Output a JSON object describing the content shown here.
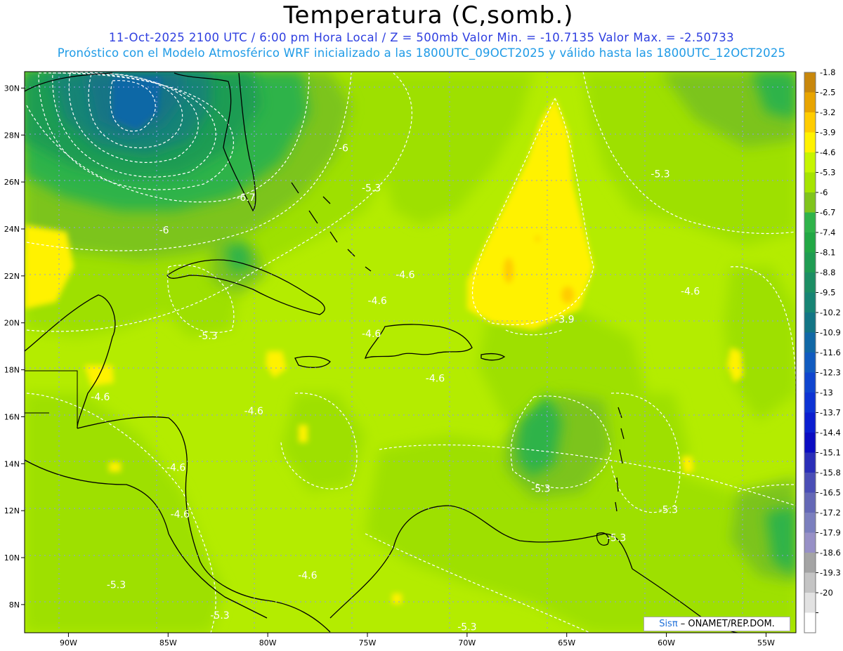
{
  "header": {
    "title": "Temperatura (C,somb.)",
    "subtitle_line1": "11-Oct-2025  2100 UTC / 6:00 pm Hora Local / Z = 500mb  Valor Min. = -10.7135  Valor Max. = -2.50733",
    "subtitle_line2": "Pronóstico con el Modelo Atmosférico WRF inicializado a las 1800UTC_09OCT2025 y válido hasta las  1800UTC_12OCT2025"
  },
  "map": {
    "projection": "lat-lon",
    "lon_range": [
      -92.2,
      -53.5
    ],
    "lat_range": [
      6.8,
      30.7
    ],
    "lon_ticks": [
      {
        "value": -90,
        "label": "90W"
      },
      {
        "value": -85,
        "label": "85W"
      },
      {
        "value": -80,
        "label": "80W"
      },
      {
        "value": -75,
        "label": "75W"
      },
      {
        "value": -70,
        "label": "70W"
      },
      {
        "value": -65,
        "label": "65W"
      },
      {
        "value": -60,
        "label": "60W"
      },
      {
        "value": -55,
        "label": "55W"
      }
    ],
    "lat_ticks": [
      {
        "value": 30,
        "label": "30N"
      },
      {
        "value": 28,
        "label": "28N"
      },
      {
        "value": 26,
        "label": "26N"
      },
      {
        "value": 24,
        "label": "24N"
      },
      {
        "value": 22,
        "label": "22N"
      },
      {
        "value": 20,
        "label": "20N"
      },
      {
        "value": 18,
        "label": "18N"
      },
      {
        "value": 16,
        "label": "16N"
      },
      {
        "value": 14,
        "label": "14N"
      },
      {
        "value": 12,
        "label": "12N"
      },
      {
        "value": 10,
        "label": "10N"
      },
      {
        "value": 8,
        "label": "8N"
      }
    ],
    "grid": "dotted",
    "contour_labels": [
      {
        "text": "-6.7",
        "lon": -81.1,
        "lat": 25.2
      },
      {
        "text": "-6",
        "lon": -85.2,
        "lat": 23.8
      },
      {
        "text": "-6",
        "lon": -76.2,
        "lat": 27.3
      },
      {
        "text": "-5.3",
        "lon": -74.8,
        "lat": 25.6
      },
      {
        "text": "-5.3",
        "lon": -60.3,
        "lat": 26.2
      },
      {
        "text": "-4.6",
        "lon": -73.1,
        "lat": 21.9
      },
      {
        "text": "-4.6",
        "lon": -74.5,
        "lat": 20.8
      },
      {
        "text": "-4.6",
        "lon": -74.8,
        "lat": 19.4
      },
      {
        "text": "-4.6",
        "lon": -71.6,
        "lat": 17.5
      },
      {
        "text": "-4.6",
        "lon": -80.7,
        "lat": 16.1
      },
      {
        "text": "-4.6",
        "lon": -88.4,
        "lat": 16.7
      },
      {
        "text": "-4.6",
        "lon": -84.6,
        "lat": 13.7
      },
      {
        "text": "-4.6",
        "lon": -84.4,
        "lat": 11.7
      },
      {
        "text": "-4.6",
        "lon": -78.0,
        "lat": 9.1
      },
      {
        "text": "-4.6",
        "lon": -58.8,
        "lat": 21.2
      },
      {
        "text": "-3.9",
        "lon": -65.1,
        "lat": 20.0
      },
      {
        "text": "-5.3",
        "lon": -83.0,
        "lat": 19.3
      },
      {
        "text": "-5.3",
        "lon": -66.3,
        "lat": 12.8
      },
      {
        "text": "-5.3",
        "lon": -59.9,
        "lat": 11.9
      },
      {
        "text": "-5.3",
        "lon": -62.5,
        "lat": 10.7
      },
      {
        "text": "-5.3",
        "lon": -87.6,
        "lat": 8.7
      },
      {
        "text": "-5.3",
        "lon": -82.4,
        "lat": 7.4
      },
      {
        "text": "-5.3",
        "lon": -70.0,
        "lat": 6.9
      }
    ]
  },
  "colorbar": {
    "levels": [
      {
        "label": "-1.8",
        "color": "#c8870c"
      },
      {
        "label": "-2.5",
        "color": "#e8a400"
      },
      {
        "label": "-3.2",
        "color": "#ffcc00"
      },
      {
        "label": "-3.9",
        "color": "#fff200"
      },
      {
        "label": "-4.6",
        "color": "#c6f500"
      },
      {
        "label": "-5.3",
        "color": "#a6e400"
      },
      {
        "label": "-6",
        "color": "#80c41c"
      },
      {
        "label": "-6.7",
        "color": "#2fb34a"
      },
      {
        "label": "-7.4",
        "color": "#22a845"
      },
      {
        "label": "-8.1",
        "color": "#1f9c52"
      },
      {
        "label": "-8.8",
        "color": "#1c8e64"
      },
      {
        "label": "-9.5",
        "color": "#178474"
      },
      {
        "label": "-10.2",
        "color": "#137585"
      },
      {
        "label": "-10.9",
        "color": "#1168a6"
      },
      {
        "label": "-11.6",
        "color": "#115bc0"
      },
      {
        "label": "-12.3",
        "color": "#0f45cf"
      },
      {
        "label": "-13",
        "color": "#0d33d4"
      },
      {
        "label": "-13.7",
        "color": "#0b1ed0"
      },
      {
        "label": "-14.4",
        "color": "#0b0cc2"
      },
      {
        "label": "-15.1",
        "color": "#2a2eb8"
      },
      {
        "label": "-15.8",
        "color": "#4a4eb6"
      },
      {
        "label": "-16.5",
        "color": "#6468b6"
      },
      {
        "label": "-17.2",
        "color": "#7b7fbe"
      },
      {
        "label": "-17.9",
        "color": "#9790c6"
      },
      {
        "label": "-18.6",
        "color": "#a4a4a4"
      },
      {
        "label": "-19.3",
        "color": "#c4c4c4"
      },
      {
        "label": "-20",
        "color": "#e2e2e2"
      },
      {
        "label": "",
        "color": "#ffffff"
      }
    ]
  },
  "credit": {
    "logo": "Sisπ",
    "text": " – ONAMET/REP.DOM."
  }
}
